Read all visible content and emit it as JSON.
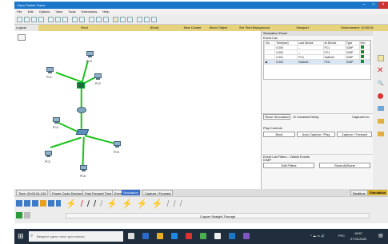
{
  "window": {
    "title": "Cisco Packet Tracer",
    "controls": [
      "–",
      "□",
      "×"
    ]
  },
  "menu": [
    "File",
    "Edit",
    "Options",
    "View",
    "Tools",
    "Extensions",
    "Help"
  ],
  "modebar": {
    "logical": "Logical",
    "root": "Root",
    "new_cluster": "[Root]",
    "move_object": "New Cluster",
    "set_tiled": "Move Object",
    "set_background": "Set Tiled Background",
    "viewport": "Viewport",
    "environment": "Environment: 10:55:28"
  },
  "devices": [
    {
      "id": "pc1",
      "label": "PC1"
    },
    {
      "id": "pc0",
      "label": "PC0"
    },
    {
      "id": "pc2",
      "label": "PC2"
    },
    {
      "id": "pc3",
      "label": "PC3"
    },
    {
      "id": "pc4",
      "label": "PC4"
    },
    {
      "id": "pc5",
      "label": "PC5"
    },
    {
      "id": "pc6",
      "label": "PC6"
    }
  ],
  "sim": {
    "title": "Simulation Panel",
    "event_list": "Event List",
    "columns": [
      "Vis.",
      "Time(sec)",
      "Last Device",
      "At Device",
      "Type",
      "Info"
    ],
    "rows": [
      {
        "time": "0.000",
        "last": "--",
        "at": "PC1",
        "type": "ICMP"
      },
      {
        "time": "0.000",
        "last": "--",
        "at": "PC1",
        "type": "ICMP"
      },
      {
        "time": "0.001",
        "last": "PC1",
        "at": "Switch0",
        "type": "ICMP"
      },
      {
        "time": "0.002",
        "last": "Switch0",
        "at": "PC6",
        "type": "ICMP"
      }
    ],
    "reset_label": "Reset Simulation",
    "constant_delay": "Constant Delay",
    "captured_to": "Captured to:",
    "play_controls": "Play Controls",
    "back": "Back",
    "auto_capture": "Auto Capture / Play",
    "capture_forward": "Capture / Forward",
    "event_filters": "Event List Filters - Visible Events",
    "filter_value": "ICMP",
    "edit_filters": "Edit Filters",
    "show_all": "Show All/None"
  },
  "statusbar": {
    "time": "Time: 00:00:04.109",
    "power": "Power Cycle Devices",
    "fast_forward": "Fast Forward Time",
    "event": "Event",
    "sim": "Simulation",
    "capture_panel": "Capture / Forward",
    "realtime": "Realtime",
    "simulation": "Simulation"
  },
  "bottom": {
    "cable_label": "Copper Straight-Through"
  },
  "taskbar": {
    "search_placeholder": "Введите здесь текст для поиска",
    "time": "18:57",
    "date": "27.03.2020",
    "lang": "РУС"
  },
  "colors": {
    "title": "#1976c8",
    "link": "#1bc21b",
    "taskbar": "#1f2d3c"
  }
}
